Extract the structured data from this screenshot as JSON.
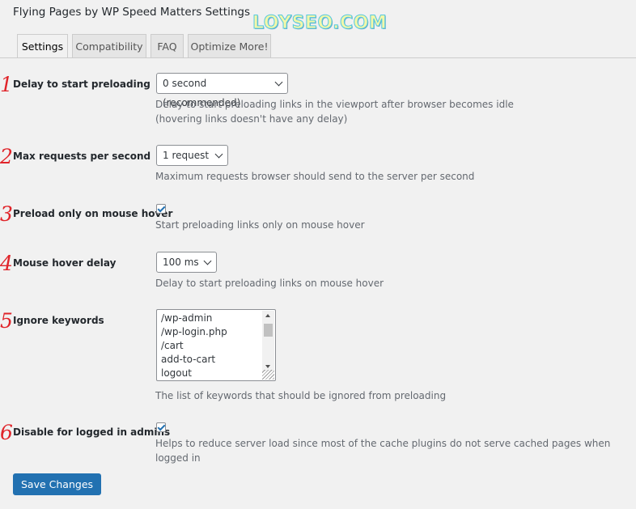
{
  "page": {
    "title": "Flying Pages by WP Speed Matters Settings",
    "watermark": "LOYSEO.COM"
  },
  "tabs": [
    {
      "label": "Settings",
      "active": true
    },
    {
      "label": "Compatibility",
      "active": false
    },
    {
      "label": "FAQ",
      "active": false
    },
    {
      "label": "Optimize More!",
      "active": false
    }
  ],
  "settings": [
    {
      "number": "1",
      "label": "Delay to start preloading",
      "value": "0 second (recommended)",
      "desc": [
        "Delay to start preloading links in the viewport after browser becomes idle",
        "(hovering links doesn't have any delay)"
      ]
    },
    {
      "number": "2",
      "label": "Max requests per second",
      "value": "1 request",
      "desc": [
        "Maximum requests browser should send to the server per second"
      ]
    },
    {
      "number": "3",
      "label": "Preload only on mouse hover",
      "checked": true,
      "desc": [
        "Start preloading links only on mouse hover"
      ]
    },
    {
      "number": "4",
      "label": "Mouse hover delay",
      "value": "100 ms",
      "desc": [
        "Delay to start preloading links on mouse hover"
      ]
    },
    {
      "number": "5",
      "label": "Ignore keywords",
      "lines": [
        "/wp-admin",
        "/wp-login.php",
        "/cart",
        "add-to-cart",
        "logout"
      ],
      "desc": [
        "The list of keywords that should be ignored from preloading"
      ]
    },
    {
      "number": "6",
      "label": "Disable for logged in admins",
      "checked": true,
      "desc": [
        "Helps to reduce server load since most of the cache plugins do not serve cached pages when logged in"
      ]
    }
  ],
  "buttons": {
    "save_label": "Save Changes"
  },
  "colors": {
    "accent": "#2271b1",
    "annotation": "#e0242a"
  }
}
